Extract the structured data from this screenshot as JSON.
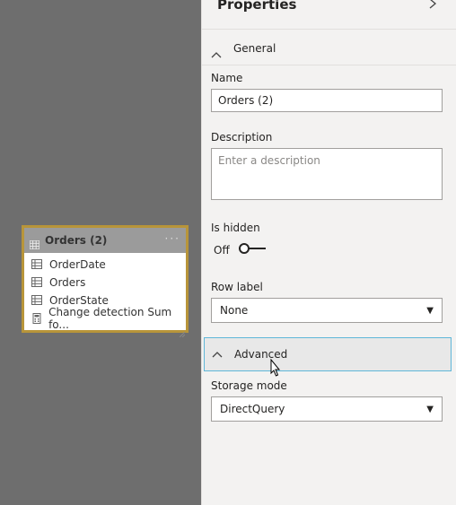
{
  "canvas": {
    "table": {
      "title": "Orders (2)",
      "more": "···",
      "fields": [
        {
          "label": "OrderDate",
          "icon": "table-column-icon"
        },
        {
          "label": "Orders",
          "icon": "table-column-icon"
        },
        {
          "label": "OrderState",
          "icon": "table-column-icon"
        },
        {
          "label": "Change detection Sum fo...",
          "icon": "calculator-icon"
        }
      ],
      "border_color": "#b8953a"
    }
  },
  "panel": {
    "title": "Properties",
    "collapse_icon": "chevron-right-icon",
    "general": {
      "section_label": "General",
      "name_label": "Name",
      "name_value": "Orders (2)",
      "description_label": "Description",
      "description_placeholder": "Enter a description",
      "hidden_label": "Is hidden",
      "hidden_state": "Off",
      "row_label_label": "Row label",
      "row_label_value": "None"
    },
    "advanced": {
      "section_label": "Advanced",
      "storage_mode_label": "Storage mode",
      "storage_mode_value": "DirectQuery"
    }
  },
  "colors": {
    "canvas_bg": "#6e6e6e",
    "panel_bg": "#f3f2f1",
    "focus_border": "#5fb7d9"
  }
}
